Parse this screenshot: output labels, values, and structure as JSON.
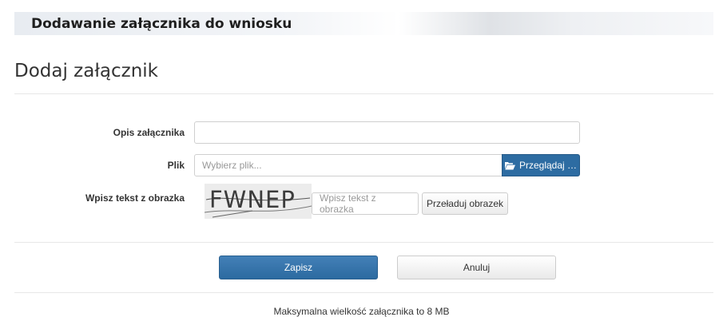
{
  "header": {
    "title": "Dodawanie załącznika do wniosku"
  },
  "page": {
    "title": "Dodaj załącznik"
  },
  "form": {
    "description": {
      "label": "Opis załącznika",
      "value": "",
      "placeholder": ""
    },
    "file": {
      "label": "Plik",
      "placeholder": "Wybierz plik...",
      "browse_label": "Przeglądaj …",
      "browse_icon": "folder-open-icon"
    },
    "captcha": {
      "label": "Wpisz tekst z obrazka",
      "image_text": "FWNEP",
      "input_placeholder": "Wpisz tekst z obrazka",
      "reload_label": "Przeładuj obrazek"
    }
  },
  "actions": {
    "save_label": "Zapisz",
    "cancel_label": "Anuluj"
  },
  "footer": {
    "note": "Maksymalna wielkość załącznika to 8 MB"
  },
  "colors": {
    "primary": "#2d6ca2",
    "border": "#cfcfcf",
    "text": "#333333"
  }
}
